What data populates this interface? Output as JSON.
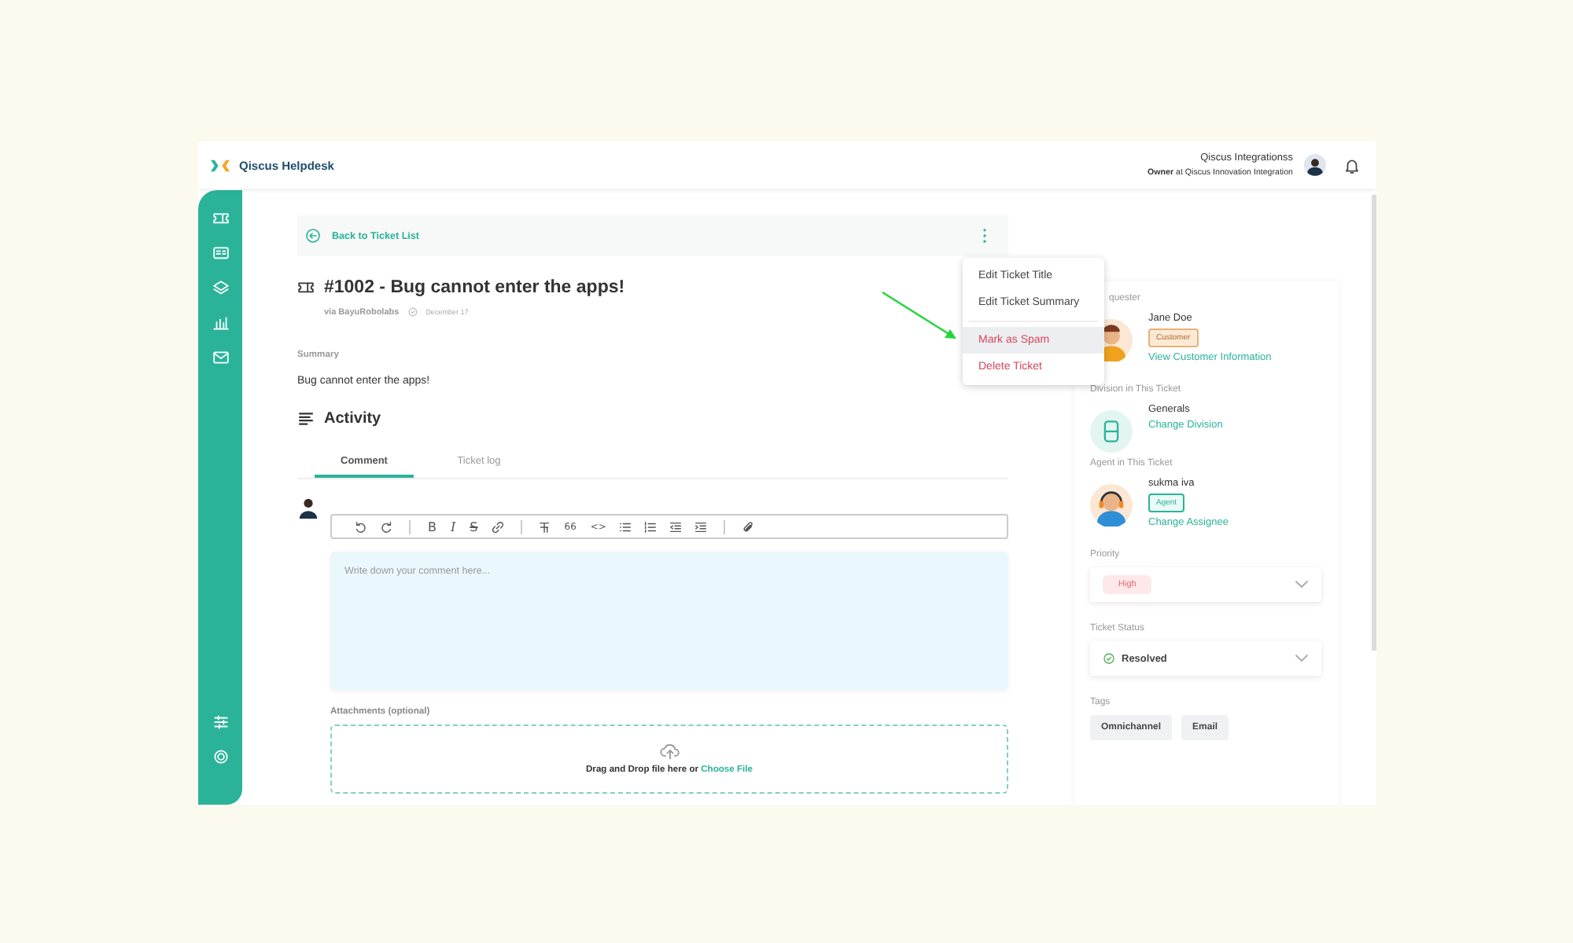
{
  "app": {
    "name": "Qiscus Helpdesk"
  },
  "user": {
    "name": "Qiscus Integrationss",
    "role": "**Owner** at Qiscus Innovation Integration"
  },
  "sidebar": {
    "top_items": [
      {
        "kind": "ticket"
      },
      {
        "kind": "card"
      },
      {
        "kind": "layers"
      },
      {
        "kind": "chart"
      },
      {
        "kind": "mail"
      }
    ],
    "bottom_items": [
      {
        "kind": "sliders"
      },
      {
        "kind": "target"
      }
    ]
  },
  "back_link": "Back to Ticket List",
  "ticket": {
    "title": "#1002 - Bug cannot enter the apps!",
    "source": "via BayuRobolabs",
    "date": "December 17",
    "summary_label": "Summary",
    "summary": "Bug cannot enter the apps!"
  },
  "activity": {
    "title": "Activity",
    "tabs": [
      {
        "label": "Comment",
        "selected": true
      },
      {
        "label": "Ticket log",
        "selected": false
      }
    ],
    "toolbar": [
      [
        {
          "kind": "undo"
        },
        {
          "kind": "redo"
        }
      ],
      [
        {
          "kind": "bold",
          "text": "B"
        },
        {
          "kind": "italic",
          "text": "I"
        },
        {
          "kind": "strike",
          "text": "S"
        },
        {
          "kind": "link"
        }
      ],
      [
        {
          "kind": "clear"
        },
        {
          "kind": "quote",
          "text": "66"
        },
        {
          "kind": "code",
          "text": "<>"
        },
        {
          "kind": "bullets"
        },
        {
          "kind": "numbers"
        },
        {
          "kind": "outdent"
        },
        {
          "kind": "indent"
        }
      ],
      [
        {
          "kind": "attach"
        }
      ]
    ],
    "comment": {
      "placeholder": "Write down your comment here..."
    },
    "attachments": {
      "label": "Attachments (optional)",
      "drop_text": "Drag and Drop file here or",
      "choose_link": "Choose File"
    }
  },
  "menu": {
    "items": [
      {
        "label": "Edit Ticket Title",
        "kind": "normal",
        "selected": false
      },
      {
        "label": "Edit Ticket Summary",
        "kind": "normal",
        "selected": false
      },
      {
        "label": "Mark as Spam",
        "kind": "danger",
        "selected": true
      },
      {
        "label": "Delete Ticket",
        "kind": "danger",
        "selected": false
      }
    ]
  },
  "details": {
    "requester": {
      "label": "quester",
      "name": "Jane Doe",
      "badge": "Customer",
      "link": "View Customer Information"
    },
    "division": {
      "label": "Division in This Ticket",
      "name": "Generals",
      "link": "Change Division"
    },
    "agent": {
      "label": "Agent in This Ticket",
      "name": "sukma iva",
      "badge": "Agent",
      "link": "Change Assignee"
    },
    "priority": {
      "label": "Priority",
      "value": "High"
    },
    "status": {
      "label": "Ticket Status",
      "value": "Resolved"
    },
    "tags": {
      "label": "Tags",
      "items": [
        "Omnichannel",
        "Email"
      ]
    }
  }
}
